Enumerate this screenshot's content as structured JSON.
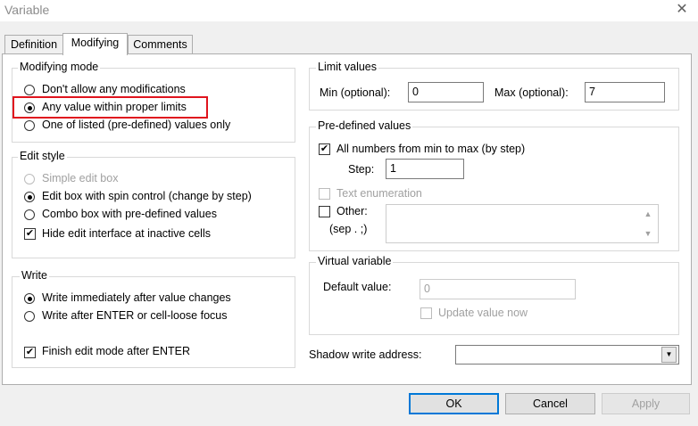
{
  "window": {
    "title": "Variable",
    "close_glyph": "✕"
  },
  "tabs": [
    "Definition",
    "Modifying",
    "Comments"
  ],
  "modifying_mode": {
    "label": "Modifying mode",
    "options": [
      "Don't allow any modifications",
      "Any value within proper limits",
      "One of listed (pre-defined) values only"
    ]
  },
  "edit_style": {
    "label": "Edit style",
    "options": [
      "Simple edit box",
      "Edit box with spin control (change by step)",
      "Combo box with pre-defined values"
    ],
    "hide_edit": "Hide edit interface at inactive cells"
  },
  "write": {
    "label": "Write",
    "options": [
      "Write immediately after value changes",
      "Write after ENTER or cell-loose focus"
    ],
    "finish_edit": "Finish edit mode after ENTER"
  },
  "limit_values": {
    "label": "Limit values",
    "min_label": "Min (optional):",
    "min_value": "0",
    "max_label": "Max (optional):",
    "max_value": "7"
  },
  "predefined": {
    "label": "Pre-defined values",
    "all_numbers": "All numbers from min to max (by step)",
    "step_label": "Step:",
    "step_value": "1",
    "text_enum": "Text enumeration",
    "other_label": "Other:",
    "sep_label": "(sep . ;)"
  },
  "virtual_variable": {
    "label": "Virtual variable",
    "default_label": "Default value:",
    "default_value": "0",
    "update_now": "Update value now"
  },
  "shadow": {
    "label": "Shadow write address:",
    "value": ""
  },
  "buttons": {
    "ok": "OK",
    "cancel": "Cancel",
    "apply": "Apply"
  }
}
